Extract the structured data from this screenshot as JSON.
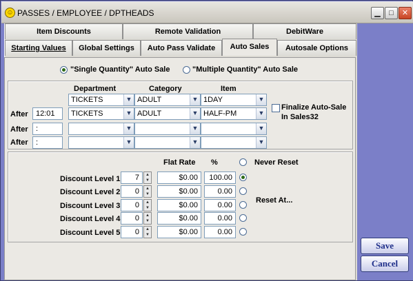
{
  "window": {
    "title": "PASSES / EMPLOYEE / DPTHEADS"
  },
  "tabs_row1": [
    "Item Discounts",
    "Remote Validation",
    "DebitWare"
  ],
  "tabs_row2": [
    "Starting Values",
    "Global Settings",
    "Auto Pass Validate",
    "Auto Sales",
    "Autosale Options"
  ],
  "active_tab": "Auto Sales",
  "mode": {
    "single": "\"Single Quantity\" Auto Sale",
    "multiple": "\"Multiple Quantity\" Auto Sale",
    "selected": "single"
  },
  "grid": {
    "headers": {
      "department": "Department",
      "category": "Category",
      "item": "Item"
    },
    "row0": {
      "department": "TICKETS",
      "category": "ADULT",
      "item": "1DAY"
    },
    "row1": {
      "label": "After",
      "time": "12:01",
      "department": "TICKETS",
      "category": "ADULT",
      "item": "HALF-PM"
    },
    "row2": {
      "label": "After",
      "time": ":",
      "department": "",
      "category": "",
      "item": ""
    },
    "row3": {
      "label": "After",
      "time": ":",
      "department": "",
      "category": "",
      "item": ""
    }
  },
  "finalize": {
    "label_line1": "Finalize Auto-Sale",
    "label_line2": "In Sales32",
    "checked": false
  },
  "discounts": {
    "headers": {
      "flat_rate": "Flat Rate",
      "percent": "%"
    },
    "levels": [
      {
        "label": "Discount Level 1",
        "qty": "7",
        "flat": "$0.00",
        "pct": "100.00"
      },
      {
        "label": "Discount Level 2",
        "qty": "0",
        "flat": "$0.00",
        "pct": "0.00"
      },
      {
        "label": "Discount Level 3",
        "qty": "0",
        "flat": "$0.00",
        "pct": "0.00"
      },
      {
        "label": "Discount Level 4",
        "qty": "0",
        "flat": "$0.00",
        "pct": "0.00"
      },
      {
        "label": "Discount Level 5",
        "qty": "0",
        "flat": "$0.00",
        "pct": "0.00"
      }
    ],
    "never_reset": "Never Reset",
    "reset_at": "Reset At...",
    "selected_reset_level": 1
  },
  "buttons": {
    "save": "Save",
    "cancel": "Cancel"
  },
  "icons": {
    "window": "smiley-icon",
    "dropdown": "chevron-down-icon",
    "spinner": "spinner-icon"
  },
  "colors": {
    "sidebar": "#7b7fc8",
    "panel": "#ebe9e4",
    "button_text": "#1f2f8a"
  }
}
